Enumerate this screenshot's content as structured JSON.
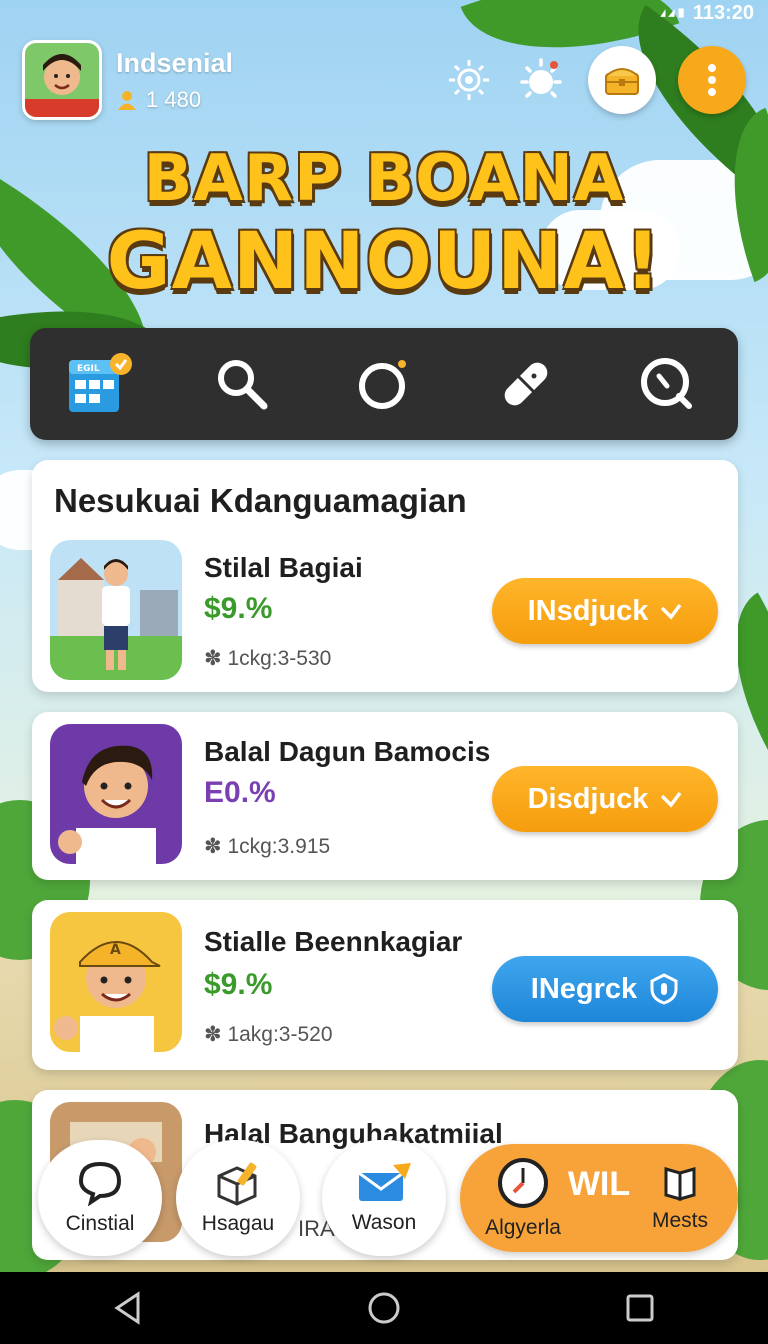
{
  "status_bar": {
    "time": "113:20"
  },
  "header": {
    "username": "Indsenial",
    "coins": "1 480"
  },
  "title": {
    "line1": "BARP BOANA",
    "line2": "GANNOUNA!"
  },
  "toolbar": {
    "tools": [
      {
        "icon": "calendar-grid-icon",
        "badge": "EGIL"
      },
      {
        "icon": "search-icon"
      },
      {
        "icon": "circle-icon"
      },
      {
        "icon": "pill-icon"
      },
      {
        "icon": "clock-search-icon"
      }
    ]
  },
  "card_section": {
    "heading": "Nesukuai Kdanguamagian",
    "items": [
      {
        "title": "Stilal Bagiai",
        "percent": "$9.%",
        "percent_color": "#3a9a2a",
        "meta": "1ckg:3-530",
        "button_label": "INsdjuck",
        "button_color": "orange",
        "button_icon": "check-icon"
      },
      {
        "title": "Balal Dagun Bamocis",
        "percent": "E0.%",
        "percent_color": "#7a3fb0",
        "meta": "1ckg:3.915",
        "button_label": "Disdjuck",
        "button_color": "orange",
        "button_icon": "check-icon"
      },
      {
        "title": "Stialle Beennkagiar",
        "percent": "$9.%",
        "percent_color": "#3a9a2a",
        "meta": "1akg:3-520",
        "button_label": "INegrck",
        "button_color": "blue",
        "button_icon": "shield-icon"
      },
      {
        "title": "Halal Banguhakatmiial"
      }
    ]
  },
  "bottom_nav": {
    "items": [
      {
        "label": "Cinstial",
        "icon": "chat-bubble-icon"
      },
      {
        "label": "Hsagau",
        "icon": "box-pencil-icon"
      },
      {
        "label": "Wason",
        "icon": "mail-icon"
      },
      {
        "label": "Algyerla",
        "icon": "clock-icon"
      },
      {
        "label": "Mests",
        "icon": "book-icon"
      }
    ],
    "partial_text": "IRA",
    "promo_text": "WIL"
  }
}
